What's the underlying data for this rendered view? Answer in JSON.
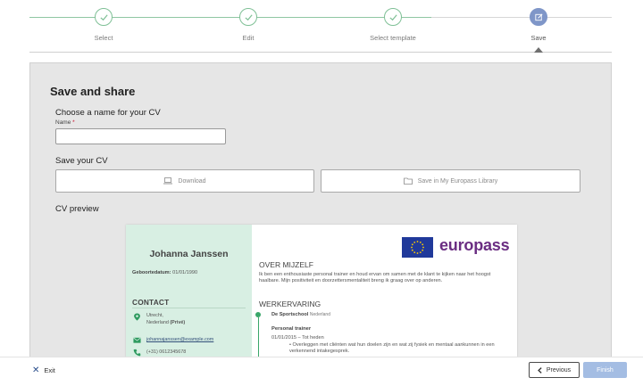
{
  "stepper": {
    "steps": [
      {
        "label": "Select",
        "state": "done"
      },
      {
        "label": "Edit",
        "state": "done"
      },
      {
        "label": "Select template",
        "state": "done"
      },
      {
        "label": "Save",
        "state": "active"
      }
    ]
  },
  "panel": {
    "title": "Save and share",
    "name_section_label": "Choose a name for your CV",
    "name_field_label": "Name",
    "name_required_mark": "*",
    "name_value": "",
    "save_section_label": "Save your CV",
    "download_label": "Download",
    "save_library_label": "Save in My Europass Library",
    "preview_label": "CV preview"
  },
  "cv_preview": {
    "name": "Johanna Janssen",
    "dob_label": "Geboortedatum:",
    "dob_value": "01/01/1990",
    "contact_heading": "CONTACT",
    "city": "Utrecht,",
    "country": "Nederland",
    "country_tag": "(Privé)",
    "email": "johannajanssen@example.com",
    "phone": "(+31) 0612345678",
    "logo_text": "europass",
    "about_heading": "OVER MIJZELF",
    "about_text": "Ik ben een enthousiaste personal trainer en houd ervan om samen met de klant te kijken naar het hoogst haalbare. Mijn positiviteit en doorzettersmentaliteit breng ik graag over op anderen.",
    "experience_heading": "WERKERVARING",
    "employer": "De Sportschool",
    "employer_country": "Nederland",
    "role": "Personal trainer",
    "role_dates": "01/01/2015 – Tot heden",
    "role_bullet": "• Overleggen met cliënten wat hun doelen zijn en wat zij fysiek en mentaal aankunnen in een verkennend intakegesprek."
  },
  "footer": {
    "exit_label": "Exit",
    "previous_label": "Previous",
    "finish_label": "Finish"
  },
  "colors": {
    "accent_green": "#7fc096",
    "active_step": "#7f96c8",
    "europass_purple": "#6a2d82",
    "finish_disabled": "#a4bde3"
  }
}
